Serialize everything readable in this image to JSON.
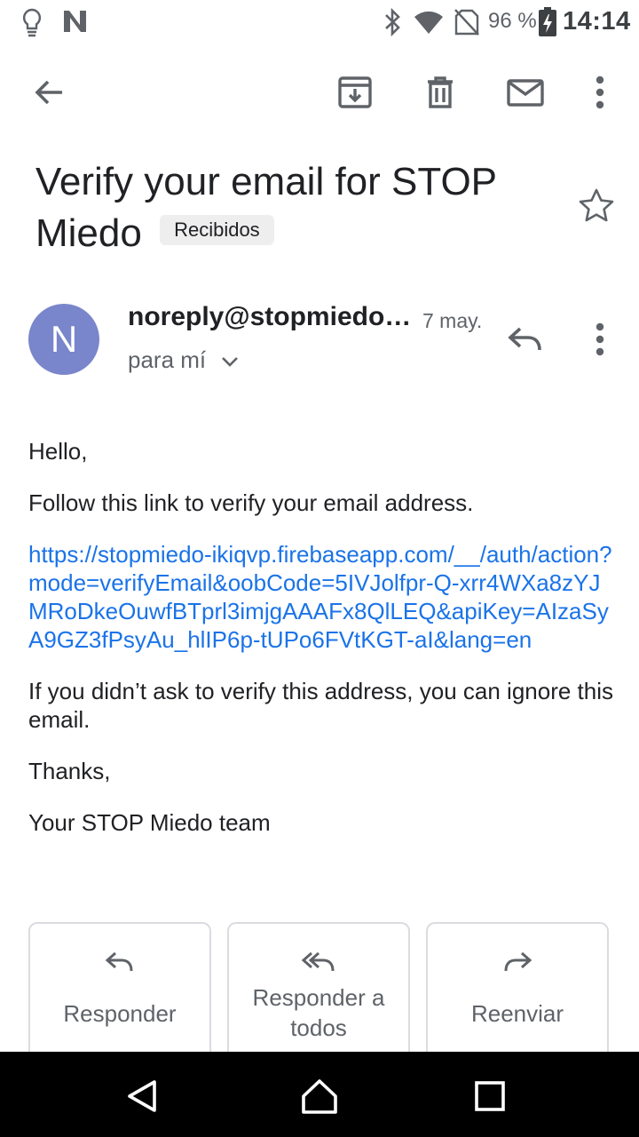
{
  "status_bar": {
    "battery": "96 %",
    "time": "14:14",
    "icons": [
      "lightbulb-icon",
      "n-app-icon",
      "bluetooth-icon",
      "wifi-icon",
      "no-sim-icon",
      "battery-charging-icon"
    ]
  },
  "toolbar": {
    "icons": [
      "back-arrow-icon",
      "archive-icon",
      "delete-icon",
      "mark-unread-icon",
      "more-vert-icon"
    ]
  },
  "email": {
    "subject": "Verify your email for STOP Miedo",
    "label": "Recibidos",
    "sender_initial": "N",
    "sender": "noreply@stopmiedo-ikiqvp.firebaseapp.com",
    "date": "7 may.",
    "to": "para mí",
    "body": {
      "greeting": "Hello,",
      "instruction": "Follow this link to verify your email address.",
      "link": "https://stopmiedo-ikiqvp.firebaseapp.com/__/auth/action?mode=verifyEmail&oobCode=5IVJolfpr-Q-xrr4WXa8zYJMRoDkeOuwfBTprl3imjgAAAFx8QlLEQ&apiKey=AIzaSyA9GZ3fPsyAu_hlIP6p-tUPo6FVtKGT-aI&lang=en",
      "ignore": "If you didn’t ask to verify this address, you can ignore this email.",
      "thanks": "Thanks,",
      "signature": "Your STOP Miedo team"
    }
  },
  "actions": {
    "reply": "Responder",
    "reply_all": "Responder a todos",
    "forward": "Reenviar"
  },
  "colors": {
    "link": "#1a73e8",
    "avatar": "#7986cb",
    "icon_gray": "#5f6368"
  }
}
